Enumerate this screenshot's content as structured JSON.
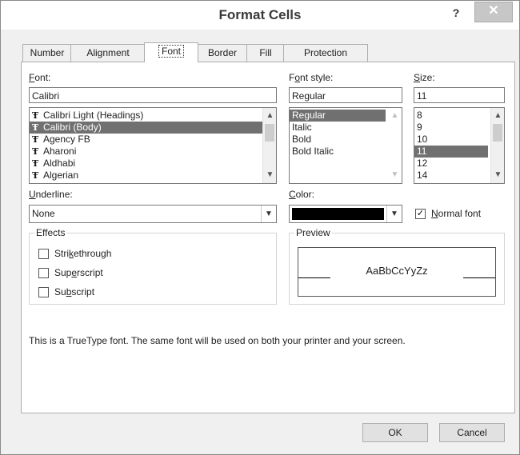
{
  "window": {
    "title": "Format Cells",
    "help_label": "?",
    "close_label": "✕"
  },
  "tabs": [
    {
      "label": "Number"
    },
    {
      "label": "Alignment"
    },
    {
      "label": "Font"
    },
    {
      "label": "Border"
    },
    {
      "label": "Fill"
    },
    {
      "label": "Protection"
    }
  ],
  "active_tab": "Font",
  "font": {
    "label": "Font:",
    "value": "Calibri",
    "list": [
      "Calibri Light (Headings)",
      "Calibri (Body)",
      "Agency FB",
      "Aharoni",
      "Aldhabi",
      "Algerian"
    ],
    "selected_index": 1,
    "list_icon": "truetype-font-icon"
  },
  "font_style": {
    "label": "Font style:",
    "value": "Regular",
    "list": [
      "Regular",
      "Italic",
      "Bold",
      "Bold Italic"
    ],
    "selected_index": 0
  },
  "size": {
    "label": "Size:",
    "value": "11",
    "list": [
      "8",
      "9",
      "10",
      "11",
      "12",
      "14"
    ],
    "selected_index": 3
  },
  "underline": {
    "label": "Underline:",
    "value": "None"
  },
  "color": {
    "label": "Color:",
    "value_color": "#000000"
  },
  "normal_font": {
    "label": "Normal font",
    "checked": true
  },
  "effects": {
    "title": "Effects",
    "items": [
      {
        "label": "Strikethrough",
        "checked": false
      },
      {
        "label": "Superscript",
        "checked": false
      },
      {
        "label": "Subscript",
        "checked": false
      }
    ]
  },
  "preview": {
    "title": "Preview",
    "sample": "AaBbCcYyZz"
  },
  "info_text": "This is a TrueType font.  The same font will be used on both your printer and your screen.",
  "buttons": {
    "ok": "OK",
    "cancel": "Cancel"
  },
  "colors": {
    "selection": "#707070",
    "window_bg": "#f0f0f0",
    "close_button": "#c7c7c7"
  }
}
